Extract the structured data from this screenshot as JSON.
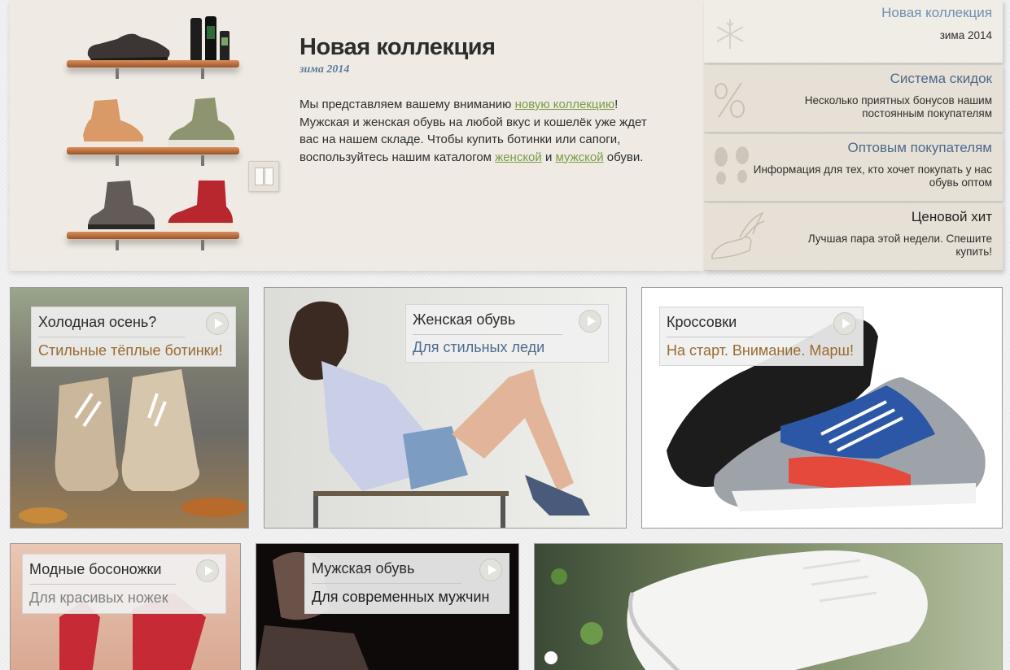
{
  "hero": {
    "title": "Новая коллекция",
    "subtitle": "зима 2014",
    "text_1": "Мы представляем вашему вниманию ",
    "link_new": "новую коллекцию",
    "text_2": "! Мужская и женская обувь на любой вкус и кошелёк уже ждет вас на нашем складе. Чтобы купить ботинки или сапоги, воспользуйтесь нашим каталогом ",
    "link_women": "женской",
    "text_3": " и ",
    "link_men": "мужской",
    "text_4": " обуви."
  },
  "sidebar": {
    "items": [
      {
        "title": "Новая коллекция",
        "text": "зима 2014",
        "icon": "snowflake-icon"
      },
      {
        "title": "Система скидок",
        "text": "Несколько приятных бонусов нашим постоянным покупателям",
        "icon": "percent-icon"
      },
      {
        "title": "Оптовым покупателям",
        "text": "Информация для тех, кто хочет покупать у нас обувь оптом",
        "icon": "footprints-icon"
      },
      {
        "title": "Ценовой хит",
        "text": "Лучшая пара этой недели. Спешите купить!",
        "icon": "winged-shoe-icon"
      }
    ]
  },
  "tiles": [
    {
      "title": "Холодная осень?",
      "subtitle": "Стильные тёплые ботинки!",
      "subtitle_color": "#9a6a2e"
    },
    {
      "title": "Женская обувь",
      "subtitle": "Для стильных леди",
      "subtitle_color": "#4f6b8c"
    },
    {
      "title": "Кроссовки",
      "subtitle": "На старт. Внимание. Марш!",
      "subtitle_color": "#9a6a2e"
    },
    {
      "title": "Модные босоножки",
      "subtitle": "Для красивых ножек",
      "subtitle_color": "#808080"
    },
    {
      "title": "Мужская обувь",
      "subtitle": "Для современных мужчин",
      "subtitle_color": "#1f1f1f"
    }
  ]
}
